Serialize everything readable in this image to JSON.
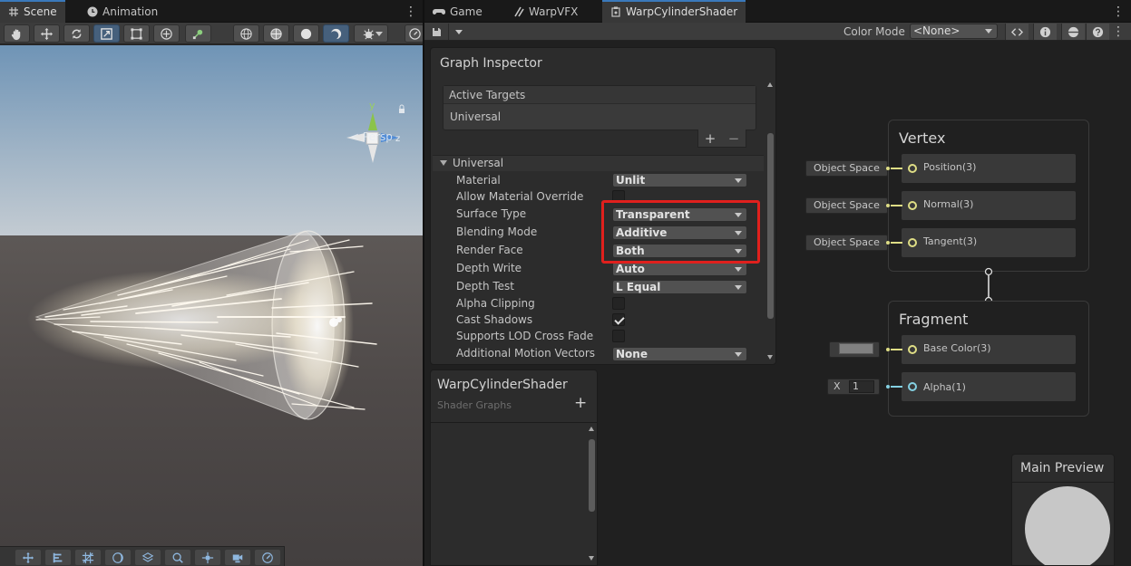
{
  "scene_window": {
    "tabs": [
      {
        "label": "Scene",
        "icon": "grid-icon",
        "active": true
      },
      {
        "label": "Animation",
        "icon": "clock-icon",
        "active": false
      }
    ],
    "gizmo": {
      "y_label": "y",
      "z_label": "z",
      "projection_label": "Persp"
    }
  },
  "shader_window": {
    "tabs": [
      {
        "label": "Game",
        "icon": "gamepad-icon",
        "active": false
      },
      {
        "label": "WarpVFX",
        "icon": "vfx-icon",
        "active": false
      },
      {
        "label": "WarpCylinderShader",
        "icon": "shadergraph-icon",
        "active": true
      }
    ],
    "toolbar": {
      "color_mode_label": "Color Mode",
      "color_mode_value": "<None>"
    },
    "graph_inspector": {
      "title": "Graph Inspector",
      "active_targets_label": "Active Targets",
      "targets": [
        "Universal"
      ],
      "add_symbol": "+",
      "remove_symbol": "−",
      "section_label": "Universal",
      "properties": [
        {
          "label": "Material",
          "type": "dropdown",
          "value": "Unlit"
        },
        {
          "label": "Allow Material Override",
          "type": "checkbox",
          "checked": false
        },
        {
          "label": "Surface Type",
          "type": "dropdown",
          "value": "Transparent"
        },
        {
          "label": "Blending Mode",
          "type": "dropdown",
          "value": "Additive"
        },
        {
          "label": "Render Face",
          "type": "dropdown",
          "value": "Both"
        },
        {
          "label": "Depth Write",
          "type": "dropdown",
          "value": "Auto"
        },
        {
          "label": "Depth Test",
          "type": "dropdown",
          "value": "L Equal"
        },
        {
          "label": "Alpha Clipping",
          "type": "checkbox",
          "checked": false
        },
        {
          "label": "Cast Shadows",
          "type": "checkbox",
          "checked": true
        },
        {
          "label": "Supports LOD Cross Fade",
          "type": "checkbox",
          "checked": false
        },
        {
          "label": "Additional Motion Vectors",
          "type": "dropdown",
          "value": "None"
        }
      ]
    },
    "blackboard": {
      "title": "WarpCylinderShader",
      "subtitle": "Shader Graphs",
      "add_symbol": "+"
    },
    "vertex_node": {
      "title": "Vertex",
      "blocks": [
        {
          "label": "Position(3)",
          "slot": "Object Space"
        },
        {
          "label": "Normal(3)",
          "slot": "Object Space"
        },
        {
          "label": "Tangent(3)",
          "slot": "Object Space"
        }
      ]
    },
    "fragment_node": {
      "title": "Fragment",
      "blocks": [
        {
          "label": "Base Color(3)",
          "slot_color": "#808080"
        },
        {
          "label": "Alpha(1)",
          "slot_axis": "X",
          "slot_value": "1"
        }
      ]
    },
    "main_preview": {
      "title": "Main Preview"
    },
    "colors": {
      "highlight": "#e0201d",
      "vector3_port": "#dedd85",
      "float_port": "#84d0e2",
      "base_color_swatch": "#808080",
      "preview_sphere": "#c7c7c7"
    }
  }
}
